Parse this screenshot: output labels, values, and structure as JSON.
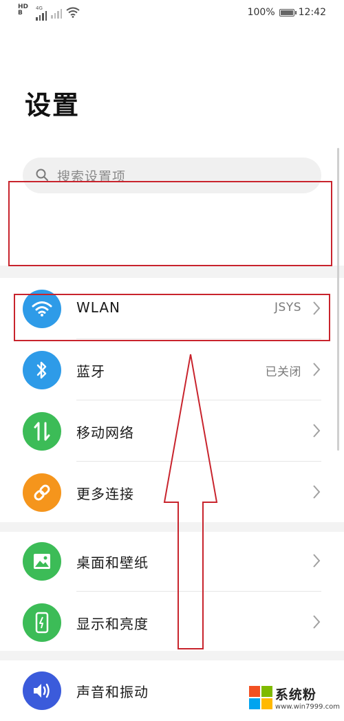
{
  "status_bar": {
    "hd_top": "HD",
    "hd_bottom": "B",
    "net_label": "4G",
    "battery": "100%",
    "time": "12:42"
  },
  "page_title": "设置",
  "search": {
    "placeholder": "搜索设置项"
  },
  "groups": [
    {
      "items": [
        {
          "label": "WLAN",
          "value": "JSYS",
          "icon": "wifi-icon",
          "color": "#2e9be8"
        },
        {
          "label": "蓝牙",
          "value": "已关闭",
          "icon": "bluetooth-icon",
          "color": "#2e9be8"
        },
        {
          "label": "移动网络",
          "value": "",
          "icon": "mobile-data-icon",
          "color": "#3cbc57"
        },
        {
          "label": "更多连接",
          "value": "",
          "icon": "link-icon",
          "color": "#f5951c"
        }
      ]
    },
    {
      "items": [
        {
          "label": "桌面和壁纸",
          "value": "",
          "icon": "wallpaper-icon",
          "color": "#3cbc57"
        },
        {
          "label": "显示和亮度",
          "value": "",
          "icon": "display-icon",
          "color": "#3cbc57"
        }
      ]
    },
    {
      "items": [
        {
          "label": "声音和振动",
          "value": "",
          "icon": "sound-icon",
          "color": "#3b5bdb"
        }
      ]
    }
  ],
  "watermark": {
    "title": "系统粉",
    "url": "www.win7999.com"
  },
  "colors": {
    "annotation": "#c8232c"
  }
}
